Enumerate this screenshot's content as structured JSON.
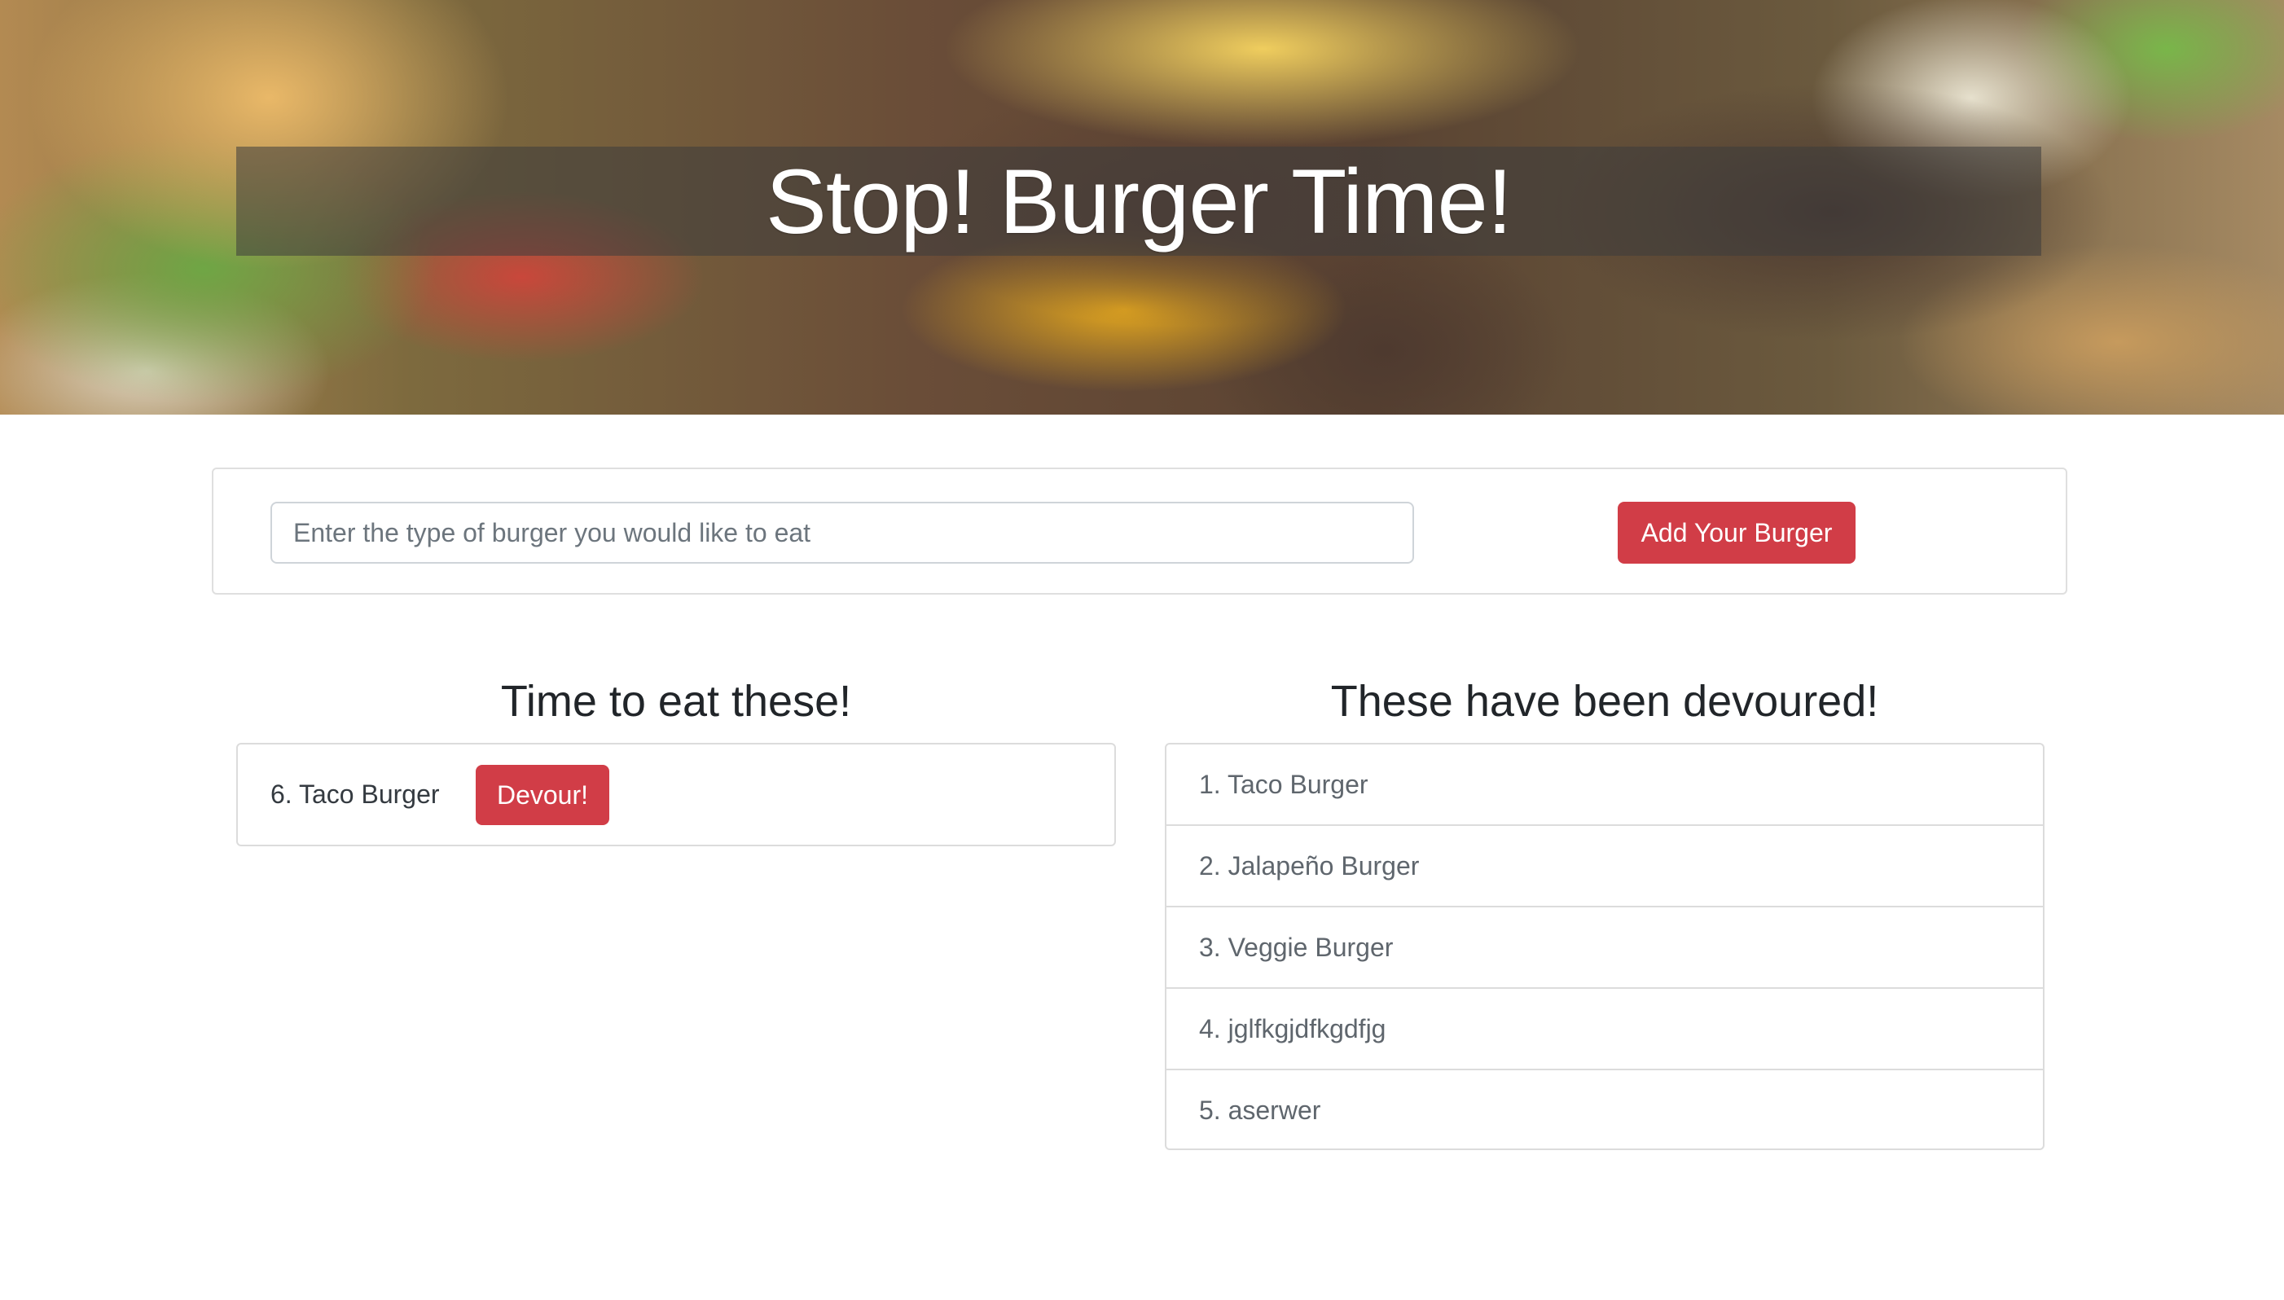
{
  "hero": {
    "title": "Stop! Burger Time!"
  },
  "form": {
    "input_value": "",
    "input_placeholder": "Enter the type of burger you would like to eat",
    "add_button_label": "Add Your Burger"
  },
  "to_eat": {
    "heading": "Time to eat these!",
    "items": [
      {
        "label": "6. Taco Burger",
        "button_label": "Devour!"
      }
    ]
  },
  "devoured": {
    "heading": "These have been devoured!",
    "items": [
      {
        "label": "1. Taco Burger"
      },
      {
        "label": "2. Jalapeño Burger"
      },
      {
        "label": "3. Veggie Burger"
      },
      {
        "label": "4. jglfkgjdfkgdfjg"
      },
      {
        "label": "5. aserwer"
      }
    ]
  },
  "colors": {
    "accent_red": "#d13d47",
    "border": "#dcdcdc",
    "hero_band": "rgba(60,60,60,0.55)"
  }
}
